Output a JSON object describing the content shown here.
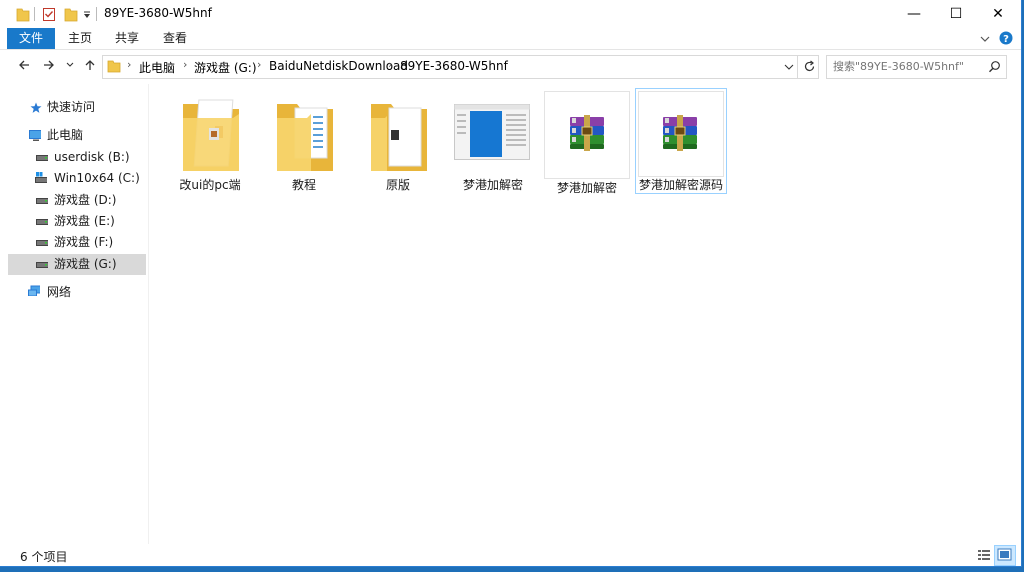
{
  "window": {
    "title": "89YE-3680-W5hnf"
  },
  "window_controls": {
    "minimize": "—",
    "maximize": "☐",
    "close": "✕"
  },
  "ribbon": {
    "tabs": [
      "文件",
      "主页",
      "共享",
      "查看"
    ]
  },
  "address": {
    "crumbs": [
      "此电脑",
      "游戏盘 (G:)",
      "BaiduNetdiskDownload",
      "89YE-3680-W5hnf"
    ]
  },
  "search": {
    "placeholder": "搜索\"89YE-3680-W5hnf\""
  },
  "sidebar": {
    "quick_access": "快速访问",
    "this_pc": "此电脑",
    "drives": [
      "userdisk (B:)",
      "Win10x64 (C:)",
      "游戏盘 (D:)",
      "游戏盘 (E:)",
      "游戏盘 (F:)",
      "游戏盘 (G:)"
    ],
    "network": "网络",
    "selected_drive": "游戏盘 (G:)"
  },
  "files": [
    {
      "name": "改ui的pc端",
      "type": "folder"
    },
    {
      "name": "教程",
      "type": "folder"
    },
    {
      "name": "原版",
      "type": "folder"
    },
    {
      "name": "梦港加解密",
      "type": "application"
    },
    {
      "name": "梦港加解密",
      "type": "rar-archive"
    },
    {
      "name": "梦港加解密源码",
      "type": "rar-archive",
      "selected": true
    }
  ],
  "status": {
    "item_count": "6 个项目"
  },
  "colors": {
    "accent": "#1979ca",
    "selection_border": "#99d1ff",
    "folder": "#f0c64b"
  }
}
